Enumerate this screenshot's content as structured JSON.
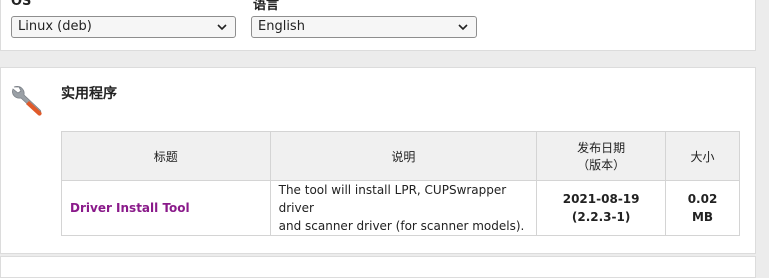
{
  "filters": {
    "os_label": "OS",
    "os_value": "Linux (deb)",
    "lang_label": "语言",
    "lang_value": "English"
  },
  "utilities": {
    "title": "实用程序",
    "columns": {
      "title": "标题",
      "description": "说明",
      "release_date_line1": "发布日期",
      "release_date_line2": "（版本）",
      "size": "大小"
    },
    "rows": [
      {
        "title": "Driver Install Tool",
        "description_line1": "The tool will install LPR, CUPSwrapper driver",
        "description_line2": "and scanner driver (for scanner models).",
        "date": "2021-08-19",
        "version": "(2.2.3-1)",
        "size_value": "0.02",
        "size_unit": "MB"
      }
    ]
  },
  "colors": {
    "link": "#8a1a8a",
    "wrench": "#e05a2a"
  },
  "icons": {
    "wrench": "wrench-icon",
    "chevron": "chevron-down-icon"
  }
}
